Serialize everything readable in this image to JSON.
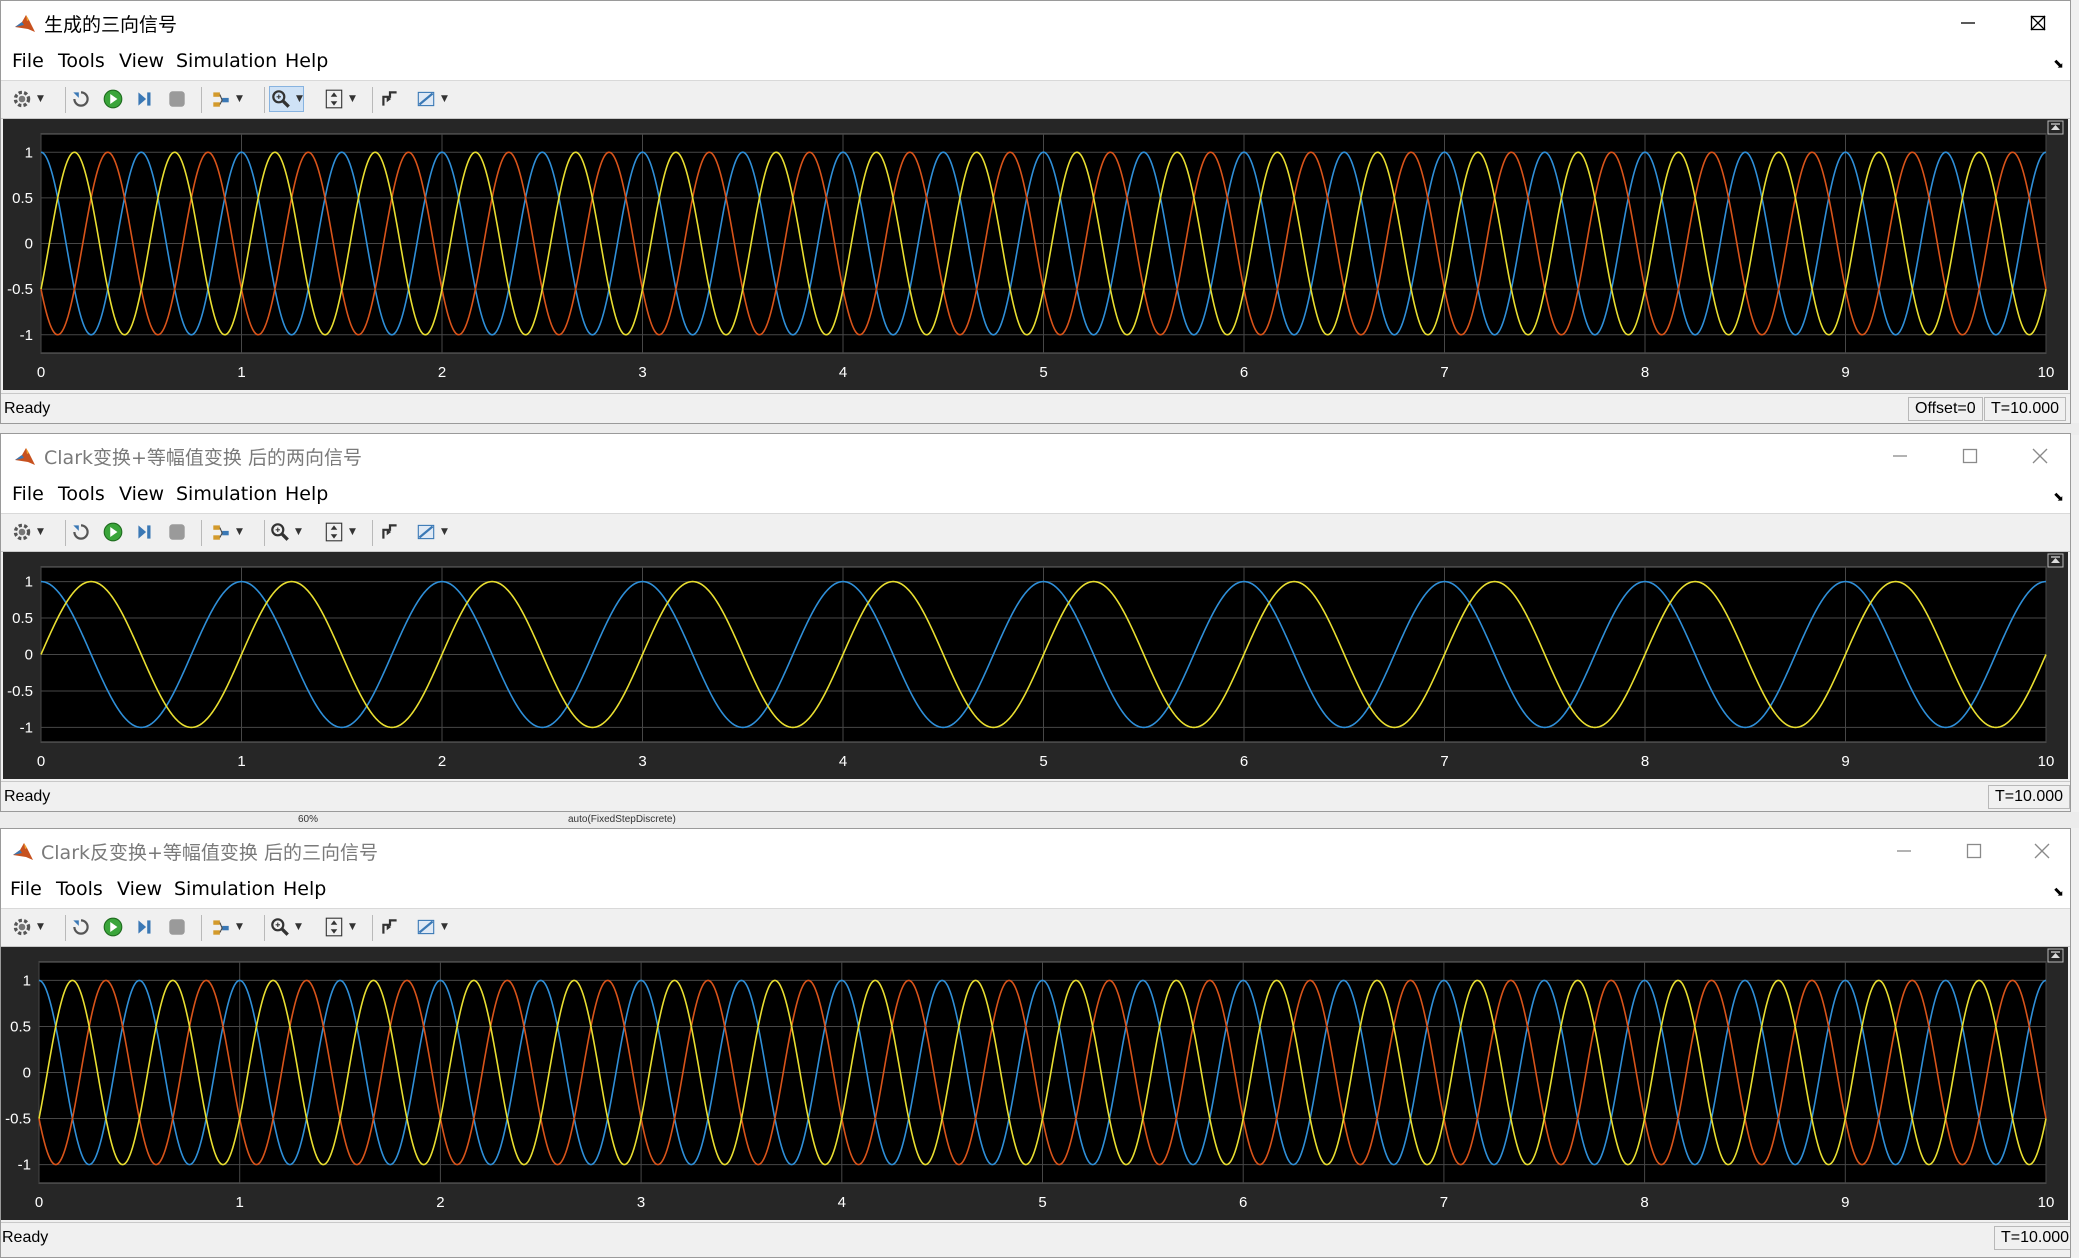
{
  "menu": [
    "File",
    "Tools",
    "View",
    "Simulation",
    "Help"
  ],
  "background": {
    "zoom_label": "60%",
    "solver_label": "auto(FixedStepDiscrete)"
  },
  "colors": {
    "blue": "#2f8fd8",
    "red": "#d9541a",
    "yellow": "#e9df31",
    "plot_bg": "#000000",
    "frame_bg": "#262626",
    "grid": "#474747"
  },
  "toolbar_icons": [
    "settings-icon",
    "restore-icon",
    "run-icon",
    "step-forward-icon",
    "stop-icon",
    "highlight-icon",
    "zoom-icon",
    "scale-axes-icon",
    "triggers-icon",
    "measurements-icon"
  ],
  "windows": [
    {
      "id": "w1",
      "title": "生成的三向信号",
      "active": true,
      "status": "Ready",
      "offset": "Offset=0",
      "time": "T=10.000",
      "chart_data": {
        "type": "line",
        "title": "",
        "xlabel": "",
        "ylabel": "",
        "xlim": [
          0,
          10
        ],
        "ylim": [
          -1.2,
          1.2
        ],
        "grid": true,
        "x_ticks": [
          "0",
          "1",
          "2",
          "3",
          "4",
          "5",
          "6",
          "7",
          "8",
          "9",
          "10"
        ],
        "y_ticks": [
          "1",
          "0.5",
          "0",
          "-0.5",
          "-1"
        ],
        "frequency_hz": 2.0,
        "series": [
          {
            "color": "#2f8fd8",
            "amplitude": 1,
            "phase_deg": 90
          },
          {
            "color": "#d9541a",
            "amplitude": 1,
            "phase_deg": -150
          },
          {
            "color": "#e9df31",
            "amplitude": 1,
            "phase_deg": -30
          }
        ]
      }
    },
    {
      "id": "w2",
      "title": "Clark变换+等幅值变换 后的两向信号",
      "active": false,
      "status": "Ready",
      "offset": "",
      "time": "T=10.000",
      "chart_data": {
        "type": "line",
        "title": "",
        "xlabel": "",
        "ylabel": "",
        "xlim": [
          0,
          10
        ],
        "ylim": [
          -1.2,
          1.2
        ],
        "grid": true,
        "x_ticks": [
          "0",
          "1",
          "2",
          "3",
          "4",
          "5",
          "6",
          "7",
          "8",
          "9",
          "10"
        ],
        "y_ticks": [
          "1",
          "0.5",
          "0",
          "-0.5",
          "-1"
        ],
        "frequency_hz": 1.0,
        "series": [
          {
            "color": "#2f8fd8",
            "amplitude": 1,
            "phase_deg": 90
          },
          {
            "color": "#e9df31",
            "amplitude": 1,
            "phase_deg": 0
          }
        ]
      }
    },
    {
      "id": "w3",
      "title": "Clark反变换+等幅值变换 后的三向信号",
      "active": false,
      "status": "Ready",
      "offset": "",
      "time": "T=10.000",
      "chart_data": {
        "type": "line",
        "title": "",
        "xlabel": "",
        "ylabel": "",
        "xlim": [
          0,
          10
        ],
        "ylim": [
          -1.2,
          1.2
        ],
        "grid": true,
        "x_ticks": [
          "0",
          "1",
          "2",
          "3",
          "4",
          "5",
          "6",
          "7",
          "8",
          "9",
          "10"
        ],
        "y_ticks": [
          "1",
          "0.5",
          "0",
          "-0.5",
          "-1"
        ],
        "frequency_hz": 2.0,
        "series": [
          {
            "color": "#2f8fd8",
            "amplitude": 1,
            "phase_deg": 90
          },
          {
            "color": "#d9541a",
            "amplitude": 1,
            "phase_deg": -150
          },
          {
            "color": "#e9df31",
            "amplitude": 1,
            "phase_deg": -30
          }
        ]
      }
    }
  ]
}
